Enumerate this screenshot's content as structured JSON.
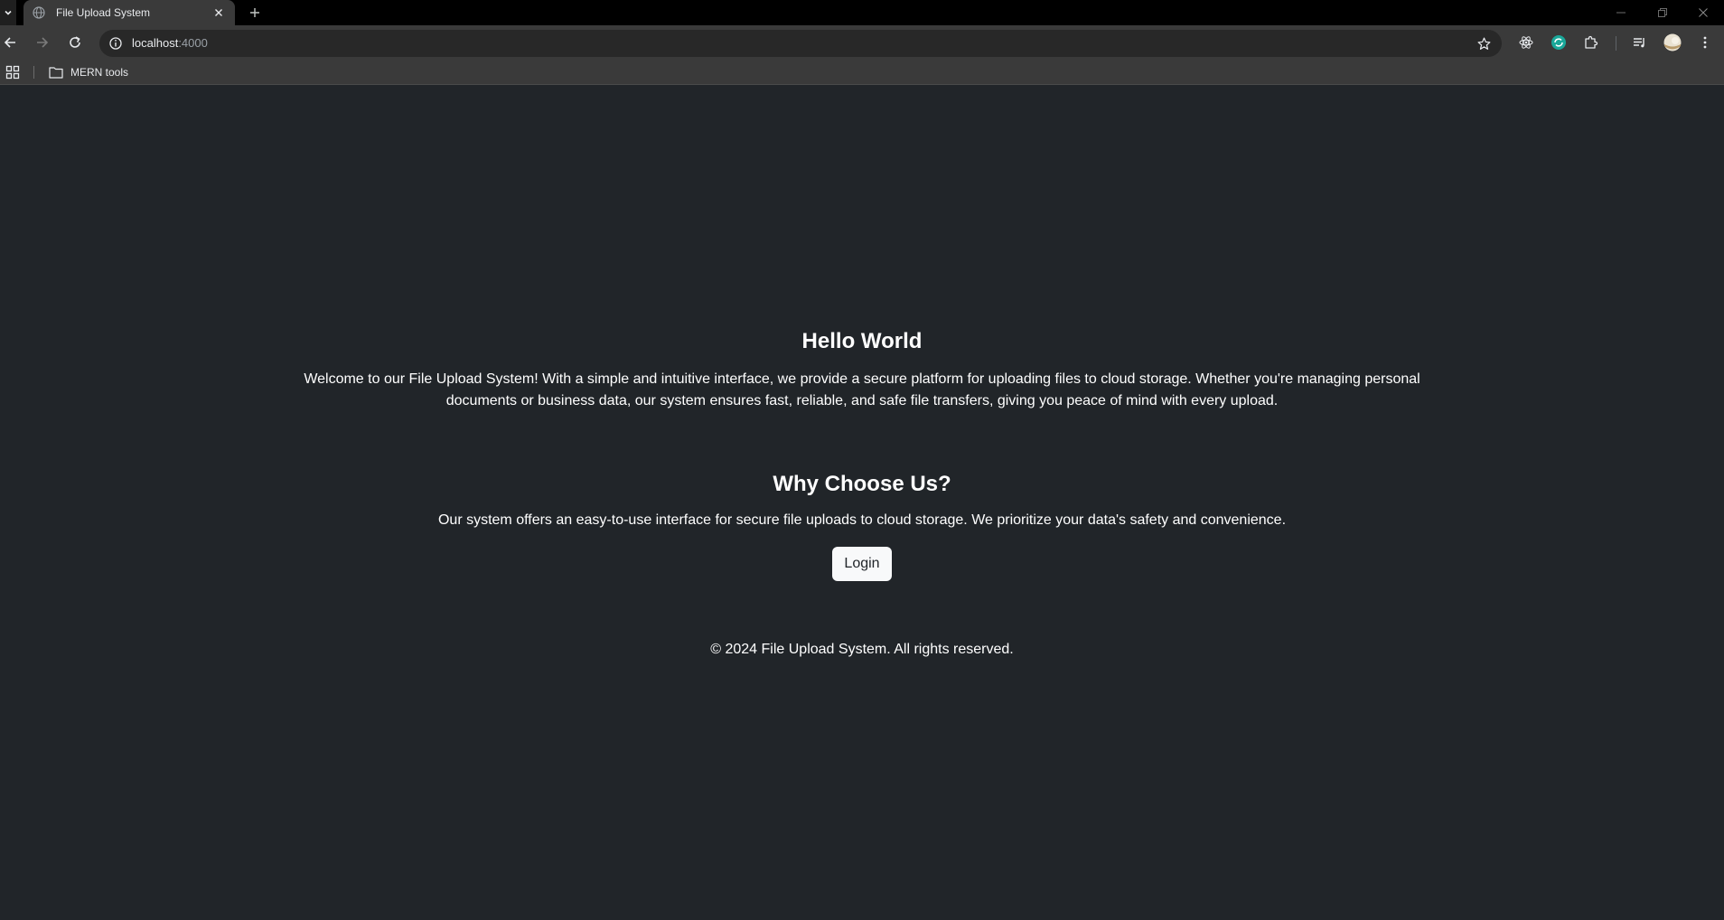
{
  "browser": {
    "tab_title": "File Upload System",
    "url_host": "localhost",
    "url_port": ":4000",
    "bookmark_folder": "MERN tools"
  },
  "hero": {
    "title": "Hello World",
    "text_line1": "Welcome to our File Upload System! With a simple and intuitive interface, we provide a secure platform for uploading files to cloud storage. Whether you're managing personal",
    "text_line2": "documents or business data, our system ensures fast, reliable, and safe file transfers, giving you peace of mind with every upload."
  },
  "why": {
    "title": "Why Choose Us?",
    "text": "Our system offers an easy-to-use interface for secure file uploads to cloud storage. We prioritize your data's safety and convenience.",
    "button_label": "Login"
  },
  "footer": {
    "text": "© 2024 File Upload System. All rights reserved."
  },
  "colors": {
    "page_background": "#212529",
    "button_background": "#f8f9fa",
    "extension_accent": "#1aa89a"
  }
}
